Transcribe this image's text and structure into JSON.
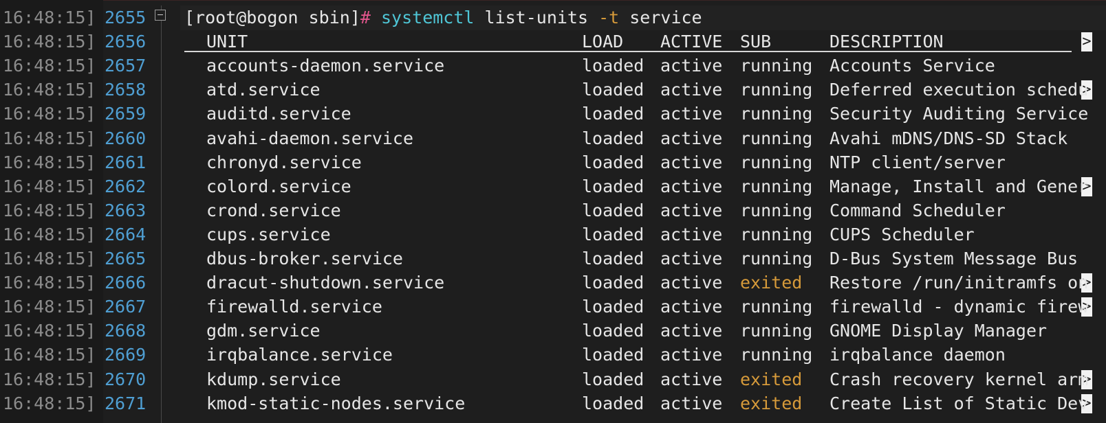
{
  "prompt": {
    "text": "[root@bogon sbin]",
    "symbol": "#",
    "command": "systemctl",
    "args_pre": " list-units ",
    "flag": "-t",
    "args_post": " service"
  },
  "header": {
    "unit": "UNIT",
    "load": "LOAD",
    "active": "ACTIVE",
    "sub": "SUB",
    "description": "DESCRIPTION",
    "more": ">"
  },
  "lines": [
    {
      "ts": "16:48:15]",
      "num": "2655"
    },
    {
      "ts": "16:48:15]",
      "num": "2656"
    },
    {
      "ts": "16:48:15]",
      "num": "2657"
    },
    {
      "ts": "16:48:15]",
      "num": "2658"
    },
    {
      "ts": "16:48:15]",
      "num": "2659"
    },
    {
      "ts": "16:48:15]",
      "num": "2660"
    },
    {
      "ts": "16:48:15]",
      "num": "2661"
    },
    {
      "ts": "16:48:15]",
      "num": "2662"
    },
    {
      "ts": "16:48:15]",
      "num": "2663"
    },
    {
      "ts": "16:48:15]",
      "num": "2664"
    },
    {
      "ts": "16:48:15]",
      "num": "2665"
    },
    {
      "ts": "16:48:15]",
      "num": "2666"
    },
    {
      "ts": "16:48:15]",
      "num": "2667"
    },
    {
      "ts": "16:48:15]",
      "num": "2668"
    },
    {
      "ts": "16:48:15]",
      "num": "2669"
    },
    {
      "ts": "16:48:15]",
      "num": "2670"
    },
    {
      "ts": "16:48:15]",
      "num": "2671"
    }
  ],
  "services": [
    {
      "unit": "accounts-daemon.service",
      "load": "loaded",
      "active": "active",
      "sub": "running",
      "desc": "Accounts Service",
      "more": ""
    },
    {
      "unit": "atd.service",
      "load": "loaded",
      "active": "active",
      "sub": "running",
      "desc": "Deferred execution schedu",
      "more": ">"
    },
    {
      "unit": "auditd.service",
      "load": "loaded",
      "active": "active",
      "sub": "running",
      "desc": "Security Auditing Service",
      "more": ""
    },
    {
      "unit": "avahi-daemon.service",
      "load": "loaded",
      "active": "active",
      "sub": "running",
      "desc": "Avahi mDNS/DNS-SD Stack",
      "more": ""
    },
    {
      "unit": "chronyd.service",
      "load": "loaded",
      "active": "active",
      "sub": "running",
      "desc": "NTP client/server",
      "more": ""
    },
    {
      "unit": "colord.service",
      "load": "loaded",
      "active": "active",
      "sub": "running",
      "desc": "Manage, Install and Gener",
      "more": ">"
    },
    {
      "unit": "crond.service",
      "load": "loaded",
      "active": "active",
      "sub": "running",
      "desc": "Command Scheduler",
      "more": ""
    },
    {
      "unit": "cups.service",
      "load": "loaded",
      "active": "active",
      "sub": "running",
      "desc": "CUPS Scheduler",
      "more": ""
    },
    {
      "unit": "dbus-broker.service",
      "load": "loaded",
      "active": "active",
      "sub": "running",
      "desc": "D-Bus System Message Bus",
      "more": ""
    },
    {
      "unit": "dracut-shutdown.service",
      "load": "loaded",
      "active": "active",
      "sub": "exited",
      "desc": "Restore /run/initramfs on",
      "more": ">"
    },
    {
      "unit": "firewalld.service",
      "load": "loaded",
      "active": "active",
      "sub": "running",
      "desc": "firewalld - dynamic firew",
      "more": ">"
    },
    {
      "unit": "gdm.service",
      "load": "loaded",
      "active": "active",
      "sub": "running",
      "desc": "GNOME Display Manager",
      "more": ""
    },
    {
      "unit": "irqbalance.service",
      "load": "loaded",
      "active": "active",
      "sub": "running",
      "desc": "irqbalance daemon",
      "more": ""
    },
    {
      "unit": "kdump.service",
      "load": "loaded",
      "active": "active",
      "sub": "exited",
      "desc": "Crash recovery kernel arm",
      "more": ">"
    },
    {
      "unit": "kmod-static-nodes.service",
      "load": "loaded",
      "active": "active",
      "sub": "exited",
      "desc": "Create List of Static Dev",
      "more": ">"
    }
  ],
  "colors": {
    "background": "#1e1e1e",
    "timestamp": "#8c8c8c",
    "line_number": "#4f9fd3",
    "prompt_hash": "#e0558b",
    "command": "#4fc6d6",
    "flag_and_exited": "#d69a3a"
  },
  "icons": {
    "fold": "fold-collapse-icon"
  }
}
